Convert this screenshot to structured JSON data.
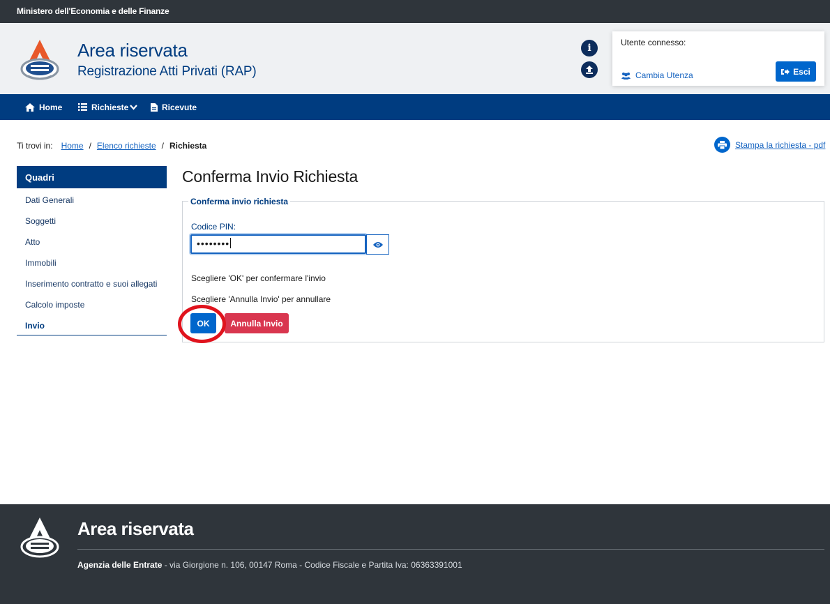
{
  "topbar": {
    "ministry": "Ministero dell'Economia e delle Finanze"
  },
  "header": {
    "title": "Area riservata",
    "subtitle": "Registrazione Atti Privati (RAP)",
    "info_icon": "info-icon",
    "upload_icon": "upload-icon",
    "user_box": {
      "label": "Utente connesso:",
      "switch_user": "Cambia Utenza",
      "logout": "Esci"
    }
  },
  "nav": {
    "items": [
      {
        "label": "Home",
        "icon": "home-icon"
      },
      {
        "label": "Richieste",
        "icon": "list-icon"
      },
      {
        "label": "Ricevute",
        "icon": "file-icon"
      }
    ]
  },
  "breadcrumb": {
    "prefix": "Ti trovi in:",
    "items": [
      "Home",
      "Elenco richieste"
    ],
    "separator": "/",
    "current": "Richiesta"
  },
  "print_link": "Stampa la richiesta - pdf",
  "sidebar": {
    "heading": "Quadri",
    "items": [
      "Dati Generali",
      "Soggetti",
      "Atto",
      "Immobili",
      "Inserimento contratto e suoi allegati",
      "Calcolo imposte",
      "Invio"
    ],
    "active": "Invio"
  },
  "main": {
    "title": "Conferma Invio Richiesta",
    "fieldset_legend": "Conferma invio richiesta",
    "pin_label": "Codice PIN:",
    "pin_value": "••••••••",
    "instruction_ok": "Scegliere 'OK' per confermare l'invio",
    "instruction_cancel": "Scegliere 'Annulla Invio' per annullare",
    "ok_button": "OK",
    "cancel_button": "Annulla Invio"
  },
  "footer": {
    "title": "Area riservata",
    "agency": "Agenzia delle Entrate",
    "address": " - via Giorgione n. 106, 00147 Roma - Codice Fiscale e Partita Iva: 06363391001"
  },
  "colors": {
    "primary": "#003c80",
    "button_blue": "#0066cc",
    "danger": "#d9364f",
    "dark_bar": "#2f353b",
    "highlight_circle": "#e0131d"
  }
}
